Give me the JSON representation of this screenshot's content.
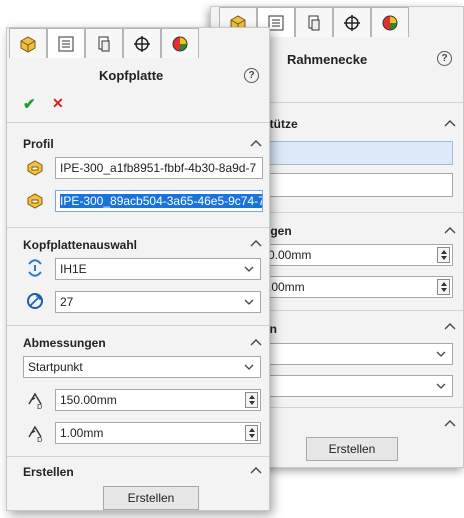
{
  "back_panel": {
    "title": "Rahmenecke",
    "help_symbol": "?",
    "sections": {
      "stuetze": "stütze",
      "abmessungen_partial": "ngen",
      "auswahl_partial": "en"
    },
    "spin1_value": "0.00mm",
    "spin2_value": ".00mm",
    "create_button": "Erstellen"
  },
  "front_panel": {
    "title": "Kopfplatte",
    "help_symbol": "?",
    "confirm_symbol": "✔",
    "cancel_symbol": "✕",
    "profil": {
      "label": "Profil",
      "item1": "IPE-300_a1fb8951-fbbf-4b30-8a9d-7",
      "item2": "IPE-300_89acb504-3a65-46e5-9c74-7"
    },
    "kopfplattenauswahl": {
      "label": "Kopfplattenauswahl",
      "type_value": "IH1E",
      "size_value": "27"
    },
    "abmessungen": {
      "label": "Abmessungen",
      "position_value": "Startpunkt",
      "offset1_value": "150.00mm",
      "offset2_value": "1.00mm"
    },
    "erstellen": {
      "label": "Erstellen",
      "button": "Erstellen"
    }
  },
  "colors": {
    "accent_selection": "#1a73d9",
    "confirm_green": "#1e9c2c",
    "cancel_red": "#d42020"
  }
}
